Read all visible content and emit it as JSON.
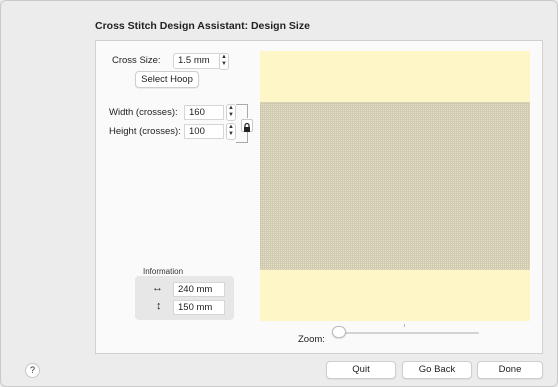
{
  "window": {
    "title": "Cross Stitch Design Assistant: Design Size"
  },
  "cross_size": {
    "label": "Cross Size:",
    "value": "1.5 mm"
  },
  "select_hoop": "Select Hoop",
  "width": {
    "label": "Width (crosses):",
    "value": "160"
  },
  "height": {
    "label": "Height (crosses):",
    "value": "100"
  },
  "information": {
    "label": "Information",
    "width_icon": "↔",
    "width_value": "240 mm",
    "height_icon": "↕",
    "height_value": "150 mm"
  },
  "zoom": {
    "label": "Zoom:"
  },
  "help": "?",
  "buttons": {
    "quit": "Quit",
    "go_back": "Go Back",
    "done": "Done"
  },
  "icons": {
    "lock": "lock-icon",
    "stepper": "stepper-icon",
    "help": "help-icon"
  },
  "colors": {
    "preview_background": "#fff6c8",
    "grid": "#e6e1c4"
  }
}
